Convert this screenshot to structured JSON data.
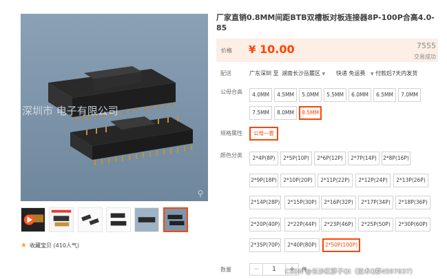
{
  "product": {
    "title": "厂家直销0.8MM间距BTB双槽板对板连接器8P-100P合高4.0-85",
    "main_image_overlay_text": "深圳市   电子有限公司"
  },
  "price": {
    "label": "价格",
    "currency_symbol": "¥",
    "value": "10.00",
    "sales_count": "7555",
    "sales_label": "交易成功"
  },
  "delivery": {
    "label": "配送",
    "from": "广东深圳 至",
    "to": "湖南长沙岳麓区",
    "shipping": "快递 免运费",
    "dispatch": "付款后7天内发货"
  },
  "height_option": {
    "label": "公母合高",
    "options": [
      "4.0MM",
      "4.5MM",
      "5.0MM",
      "5.5MM",
      "6.0MM",
      "6.5MM",
      "7.0MM",
      "7.5MM",
      "8.0MM",
      "8.5MM"
    ],
    "selected": "8.5MM"
  },
  "spec_option": {
    "label": "规格属性",
    "options": [
      "公母一套"
    ],
    "selected": "公母一套"
  },
  "color_option": {
    "label": "颜色分类",
    "options": [
      "2*4P(8P)",
      "2*5P(10P)",
      "2*6P(12P)",
      "2*7P(14P)",
      "2*8P(16P)",
      "2*9P(18P)",
      "2*10P(20P)",
      "2*11P(22P)",
      "2*12P(24P)",
      "2*13P(26P)",
      "2*14P(28P)",
      "2*15P(30P)",
      "2*16P(32P)",
      "2*17P(34P)",
      "2*18P(36P)",
      "2*20P(40P)",
      "2*22P(44P)",
      "2*23P(46P)",
      "2*25P(50P)",
      "2*30P(60P)",
      "2*35P(70P)",
      "2*40P(80P)",
      "2*50P(100P)"
    ],
    "selected": "2*50P(100P)"
  },
  "quantity": {
    "label": "数量",
    "minus": "−",
    "value": "1",
    "plus": "+",
    "unit": "件"
  },
  "favorite": {
    "label": "收藏宝贝",
    "count": "(410人气)"
  },
  "watermark": "CSDN @长沙红胖子Qt（技术Q群4597637）",
  "icons": {
    "zoom": "magnifier-icon",
    "star": "star-icon",
    "play": "play-icon"
  },
  "colors": {
    "accent": "#ff4400",
    "price_bg": "#fdeee6",
    "image_bg": "#7d95ab"
  }
}
